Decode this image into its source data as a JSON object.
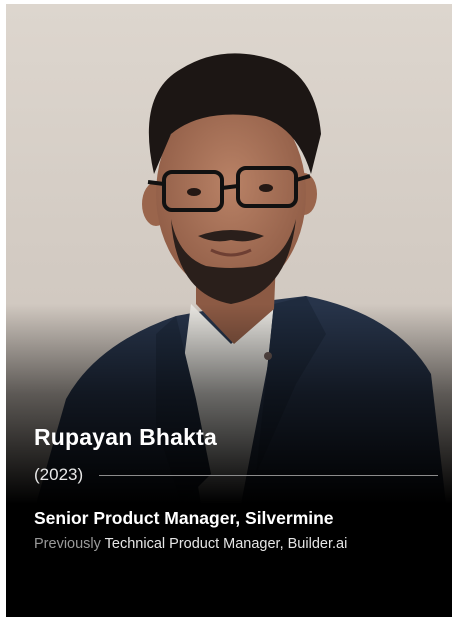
{
  "profile": {
    "name": "Rupayan Bhakta",
    "year": "(2023)",
    "current_role": "Senior Product Manager, Silvermine",
    "previous_prefix": "Previously",
    "previous_role": "Technical Product Manager, Builder.ai"
  },
  "colors": {
    "card_background": "#000000",
    "photo_wall": "#d8d0c8",
    "suit": "#27344a",
    "text_primary": "#ffffff",
    "text_muted": "#9a9a9a"
  }
}
